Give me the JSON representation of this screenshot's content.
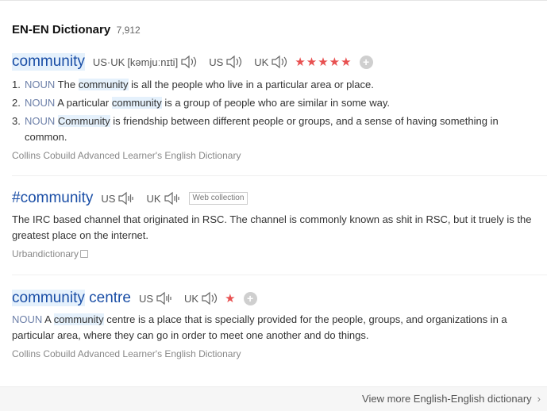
{
  "header": {
    "title": "EN-EN Dictionary",
    "count": "7,912"
  },
  "entries": [
    {
      "word": "community",
      "pron": [
        {
          "label": "US·UK",
          "phonetic": "[kəmjuːnɪti]"
        },
        {
          "label": "US"
        },
        {
          "label": "UK"
        }
      ],
      "stars": "★★★★★",
      "plus": "+",
      "definitions": [
        {
          "num": "1.",
          "pos": "NOUN",
          "pre": "The ",
          "kw": "community",
          "post": " is all the people who live in a particular area or place."
        },
        {
          "num": "2.",
          "pos": "NOUN",
          "pre": "A particular ",
          "kw": "community",
          "post": " is a group of people who are similar in some way."
        },
        {
          "num": "3.",
          "pos": "NOUN",
          "pre": "",
          "kw": "Community",
          "post": " is friendship between different people or groups, and a sense of having something in common."
        }
      ],
      "source": "Collins Cobuild Advanced Learner's English Dictionary"
    },
    {
      "word": "#community",
      "pron": [
        {
          "label": "US"
        },
        {
          "label": "UK"
        }
      ],
      "tag": "Web collection",
      "text": "The IRC based channel that originated in RSC. The channel is commonly known as shit in RSC, but it truely is the greatest place on the internet.",
      "source": "Urbandictionary"
    },
    {
      "word_kw": "community",
      "word_rest": " centre",
      "pron": [
        {
          "label": "US"
        },
        {
          "label": "UK"
        }
      ],
      "stars": "★",
      "plus": "+",
      "pos": "NOUN",
      "pre": " A ",
      "kw": "community",
      "post": " centre is a place that is specially provided for the people, groups, and organizations in a particular area, where they can go in order to meet one another and do things.",
      "source": "Collins Cobuild Advanced Learner's English Dictionary"
    }
  ],
  "footer": {
    "more": "View more English-English dictionary",
    "chevron": "›"
  },
  "icons": [
    "speaker-icon",
    "speaker-wave-icon",
    "plus-icon",
    "copy-icon",
    "chevron-right-icon"
  ],
  "colors": {
    "link": "#1a4ea6",
    "highlight": "#e5f1fc",
    "stars": "#e85151",
    "pos": "#6c7fa8"
  }
}
